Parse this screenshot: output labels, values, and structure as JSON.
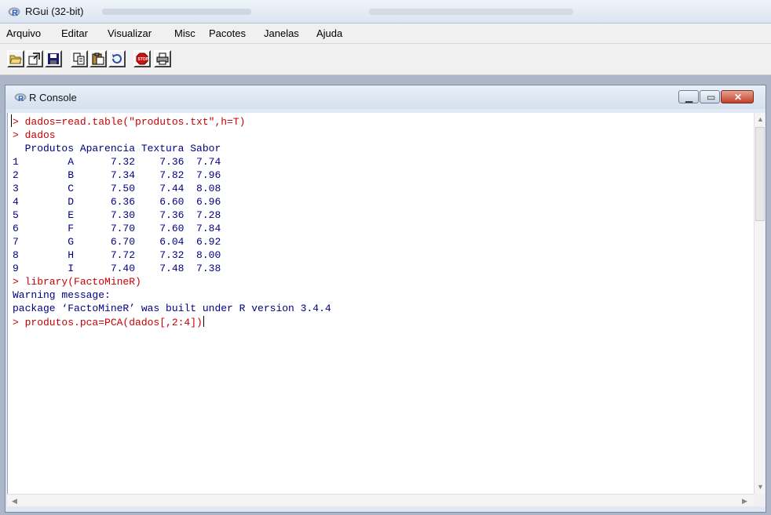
{
  "app": {
    "title": "RGui (32-bit)"
  },
  "menu": [
    "Arquivo",
    "Editar",
    "Visualizar",
    "Misc",
    "Pacotes",
    "Janelas",
    "Ajuda"
  ],
  "toolbar": {
    "buttons": [
      "open-script-icon",
      "load-workspace-icon",
      "save-icon",
      "copy-icon",
      "paste-icon",
      "refresh-icon",
      "stop-icon",
      "print-icon"
    ]
  },
  "console_window": {
    "title": "R Console",
    "lines": [
      {
        "type": "cmd",
        "text": "> dados=read.table(\"produtos.txt\",h=T)"
      },
      {
        "type": "cmd",
        "text": "> dados"
      },
      {
        "type": "out",
        "text": "  Produtos Aparencia Textura Sabor"
      },
      {
        "type": "out",
        "text": "1        A      7.32    7.36  7.74"
      },
      {
        "type": "out",
        "text": "2        B      7.34    7.82  7.96"
      },
      {
        "type": "out",
        "text": "3        C      7.50    7.44  8.08"
      },
      {
        "type": "out",
        "text": "4        D      6.36    6.60  6.96"
      },
      {
        "type": "out",
        "text": "5        E      7.30    7.36  7.28"
      },
      {
        "type": "out",
        "text": "6        F      7.70    7.60  7.84"
      },
      {
        "type": "out",
        "text": "7        G      6.70    6.04  6.92"
      },
      {
        "type": "out",
        "text": "8        H      7.72    7.32  8.00"
      },
      {
        "type": "out",
        "text": "9        I      7.40    7.48  7.38"
      },
      {
        "type": "cmd",
        "text": "> library(FactoMineR)"
      },
      {
        "type": "out",
        "text": "Warning message:"
      },
      {
        "type": "out",
        "text": "package ‘FactoMineR’ was built under R version 3.4.4"
      },
      {
        "type": "cmd",
        "text": "> produtos.pca=PCA(dados[,2:4])"
      }
    ]
  },
  "colors": {
    "command": "#c80000",
    "output": "#00007f",
    "mdi_background": "#abb7c8"
  }
}
